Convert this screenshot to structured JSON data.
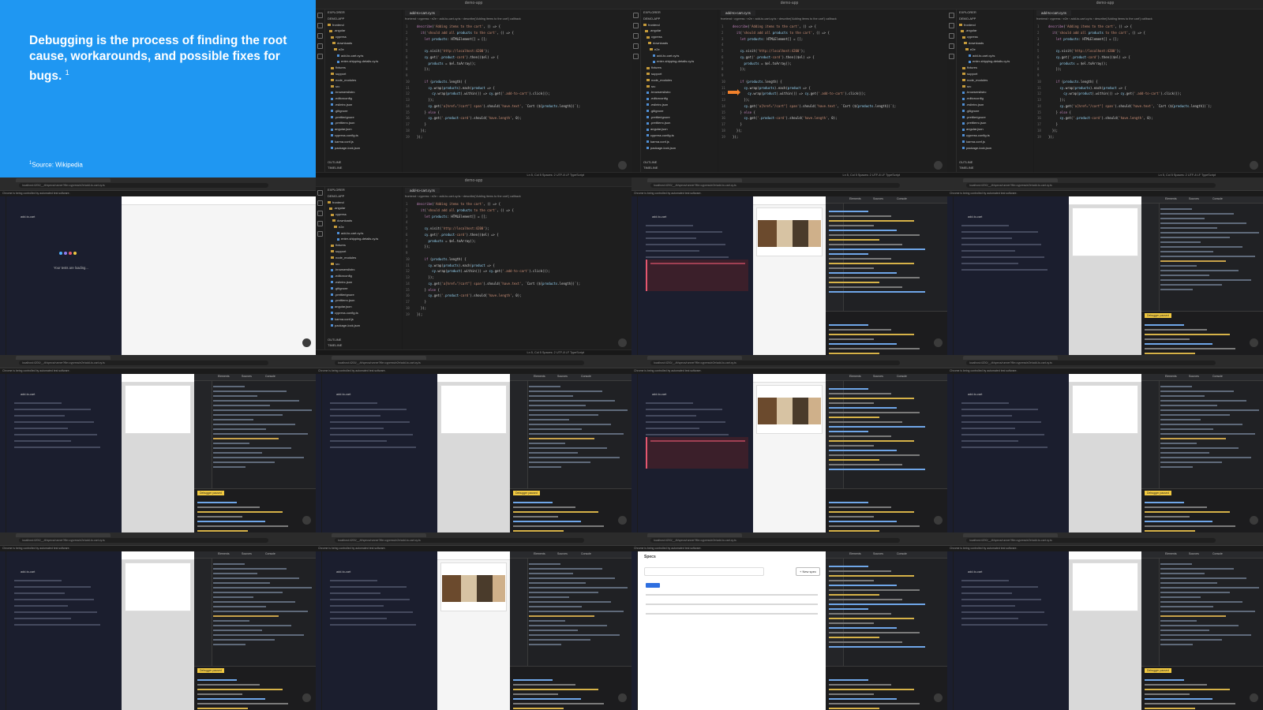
{
  "intro": {
    "headline": "Debugging is the process of finding the root cause, workarounds, and possible fixes for bugs.",
    "headline_ref": "1",
    "source_ref": "1",
    "source": "Source: Wikipedia"
  },
  "editor": {
    "window_title": "demo-app",
    "tab": "add-to-cart.cy.ts",
    "breadcrumb": "frontend › cypress › e2e › add-to-cart.cy.ts › describe('Adding items to the cart') callback",
    "explorer_header": "EXPLORER",
    "project": "DEMO-APP",
    "tree": [
      {
        "label": "frontend",
        "type": "fold"
      },
      {
        "label": ".angular",
        "type": "fold"
      },
      {
        "label": "cypress",
        "type": "fold"
      },
      {
        "label": "downloads",
        "type": "fold"
      },
      {
        "label": "e2e",
        "type": "fold"
      },
      {
        "label": "add-to-cart.cy.ts",
        "type": "file"
      },
      {
        "label": "enter-shipping-details.cy.ts",
        "type": "file"
      },
      {
        "label": "fixtures",
        "type": "fold"
      },
      {
        "label": "support",
        "type": "fold"
      },
      {
        "label": "node_modules",
        "type": "fold"
      },
      {
        "label": "src",
        "type": "fold"
      },
      {
        "label": ".browserslistrc",
        "type": "file"
      },
      {
        "label": ".editorconfig",
        "type": "file"
      },
      {
        "label": ".eslintrc.json",
        "type": "file"
      },
      {
        "label": ".gitignore",
        "type": "file"
      },
      {
        "label": ".prettierignore",
        "type": "file"
      },
      {
        "label": ".prettierrc.json",
        "type": "file"
      },
      {
        "label": "angular.json",
        "type": "file"
      },
      {
        "label": "cypress.config.ts",
        "type": "file"
      },
      {
        "label": "karma.conf.js",
        "type": "file"
      },
      {
        "label": "package-lock.json",
        "type": "file"
      }
    ],
    "outline": "OUTLINE",
    "timeline": "TIMELINE",
    "status": "Ln 5, Col 5   Spaces: 2   UTF-8   LF   TypeScript",
    "code": [
      "describe('Adding items to the cart', () => {",
      "  it('should add all products to the cart', () => {",
      "    let products: HTMLElement[] = [];",
      "",
      "    cy.visit('http://localhost:4200');",
      "    cy.get('.product-card').then(($el) => {",
      "      products = $el.toArray();",
      "    });",
      "",
      "    if (products.length) {",
      "      cy.wrap(products).each(product => {",
      "        cy.wrap(product).within(() => cy.get('.add-to-cart').click());",
      "      });",
      "      cy.get('a[href=\"/cart\"] span').should('have.text', `Cart (${products.length})`);",
      "    } else {",
      "      cy.get('.product-card').should('have.length', 0);",
      "    }",
      "  });",
      "});"
    ]
  },
  "browser": {
    "url": "localhost:4200/__/#/specs/runner?file=cypress/e2e/add-to-cart.cy.ts",
    "banner": "Chrome is being controlled by automated test software.",
    "spec": "add-to-cart",
    "loading": "Your tests are loading...",
    "paused": "Debugger paused",
    "specs_title": "Specs",
    "new_spec": "+ New spec"
  },
  "colors": {
    "intro_bg": "#1f97f2",
    "arrow": "#f2812b",
    "dots": [
      "#4fb0ff",
      "#8f7cf0",
      "#e45770",
      "#f0c840"
    ]
  }
}
